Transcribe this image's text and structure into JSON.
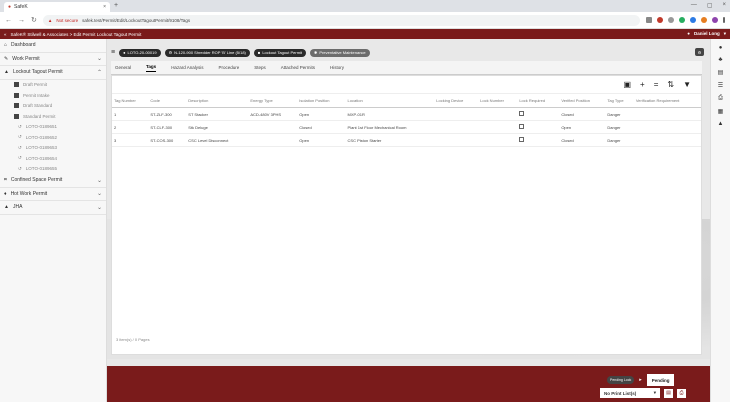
{
  "browser": {
    "tab_title": "SafeK",
    "url_warning": "Not secure",
    "url": "safek.test/Permit/Edit/LockoutTagoutPermit/9108/Tags"
  },
  "appbar": {
    "breadcrumb": "SafeK® Stilwell & Associates > Edit Permit Lockout Tagout Permit",
    "user": "Daniel Long"
  },
  "sidebar": {
    "items": [
      {
        "label": "Dashboard",
        "icon": "home-icon"
      },
      {
        "label": "Work Permit",
        "icon": "wrench-icon"
      },
      {
        "label": "Lockout Tagout Permit",
        "icon": "lock-icon"
      }
    ],
    "sub_items": [
      "Draft Permit",
      "Permit Intake",
      "Draft Standard",
      "Standard Permit"
    ],
    "sub_items2": [
      "LOTO-0189651",
      "LOTO-0189652",
      "LOTO-0189653",
      "LOTO-0189654",
      "LOTO-0189655"
    ],
    "items_after": [
      {
        "label": "Confined Space Permit",
        "icon": "grid-icon"
      },
      {
        "label": "Hot Work Permit",
        "icon": "flame-icon"
      },
      {
        "label": "JHA",
        "icon": "hardhat-icon"
      }
    ]
  },
  "toolbar": {
    "permit_id": "LOTO-20-00019",
    "equipment": "N-120-900 Shredder ROP 'B' Line (5/18)",
    "type": "Lockout Tagout Permit",
    "category": "Preventative Maintenance"
  },
  "tabs": [
    "General",
    "Tags",
    "Hazard Analysis",
    "Procedure",
    "Steps",
    "Attached Permits",
    "History"
  ],
  "table": {
    "headers": [
      "Tag Number",
      "Code",
      "Description",
      "Energy Type",
      "Isolation Position",
      "Location",
      "Locking Device",
      "Lock Number",
      "Lock Required",
      "Verified Position",
      "Tag Type",
      "Verification Requirement"
    ],
    "rows": [
      [
        "1",
        "ST-ZLF-300",
        "ST Stacker",
        "ACD-480V 3PHS",
        "Open",
        "MXP-01R",
        "",
        "",
        "",
        "Closed",
        "Danger",
        ""
      ],
      [
        "2",
        "ST-CLF-300",
        "Stk Deluge",
        "",
        "Closed",
        "Plant 1st Floor Mechanical Room",
        "",
        "",
        "",
        "Open",
        "Danger",
        ""
      ],
      [
        "3",
        "ST-COS-300",
        "CSC Level Disconnect",
        "",
        "Open",
        "CSC Piston Starter",
        "",
        "",
        "",
        "Closed",
        "Danger",
        ""
      ]
    ]
  },
  "pager": "3 item(s) / 0 Pages",
  "footer": {
    "status_chip": "Pending Lock",
    "status_button": "Pending",
    "print_select": "No Print List(s)"
  },
  "colors": {
    "brand": "#7a1b1b"
  }
}
